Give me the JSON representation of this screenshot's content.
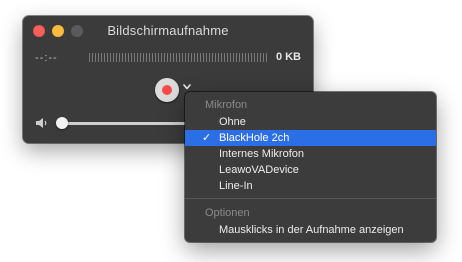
{
  "window": {
    "title": "Bildschirmaufnahme",
    "time": "--:--",
    "file_size": "0 KB"
  },
  "icons": {
    "close": "close-traffic-light",
    "minimize": "minimize-traffic-light",
    "maximize": "maximize-traffic-light-disabled",
    "record": "record-icon",
    "options": "chevron-down-icon",
    "volume": "speaker-icon"
  },
  "volume_level": 0.0,
  "menu": {
    "microphone_header": "Mikrofon",
    "microphone_items": [
      {
        "label": "Ohne",
        "selected": false
      },
      {
        "label": "BlackHole 2ch",
        "selected": true
      },
      {
        "label": "Internes Mikrofon",
        "selected": false
      },
      {
        "label": "LeawoVADevice",
        "selected": false
      },
      {
        "label": "Line-In",
        "selected": false
      }
    ],
    "options_header": "Optionen",
    "options_items": [
      {
        "label": "Mausklicks in der Aufnahme anzeigen"
      }
    ],
    "check_mark": "✓"
  },
  "colors": {
    "selection": "#2c6ee6",
    "record": "#fb4b4b"
  }
}
